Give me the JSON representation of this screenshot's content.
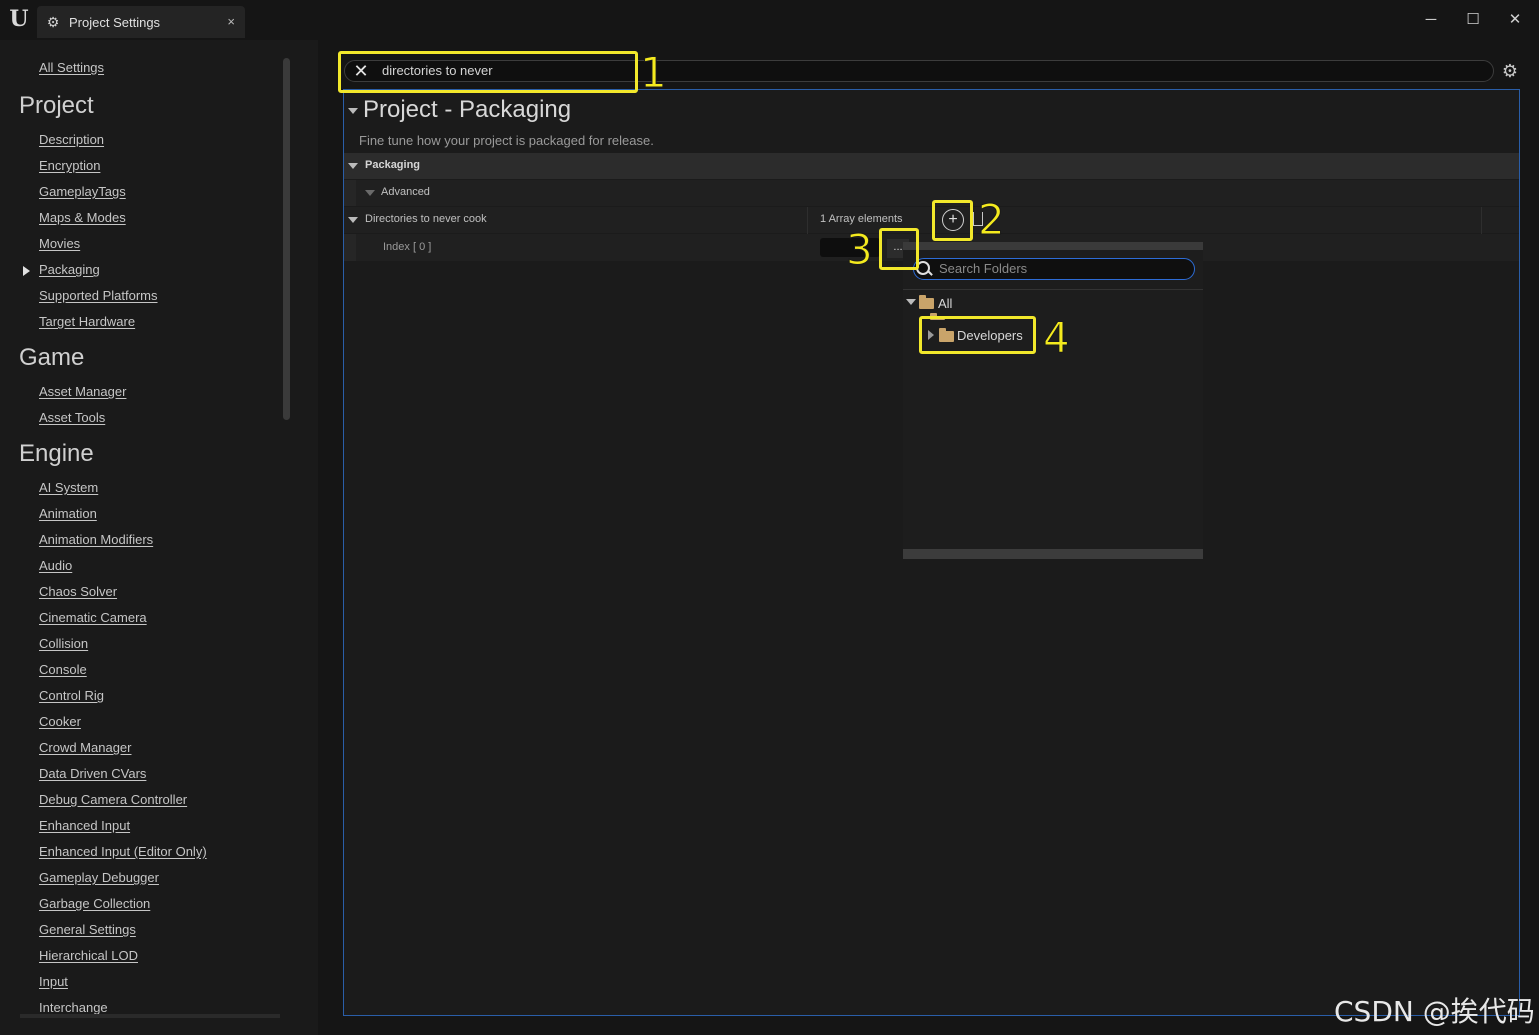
{
  "titlebar": {
    "tab_label": "Project Settings",
    "tab_close": "×",
    "minimize": "─",
    "maximize": "☐",
    "close": "✕"
  },
  "sidebar": {
    "all_settings": "All Settings",
    "sections": [
      {
        "heading": "Project",
        "items": [
          "Description",
          "Encryption",
          "GameplayTags",
          "Maps & Modes",
          "Movies",
          "Packaging",
          "Supported Platforms",
          "Target Hardware"
        ]
      },
      {
        "heading": "Game",
        "items": [
          "Asset Manager",
          "Asset Tools"
        ]
      },
      {
        "heading": "Engine",
        "items": [
          "AI System",
          "Animation",
          "Animation Modifiers",
          "Audio",
          "Chaos Solver",
          "Cinematic Camera",
          "Collision",
          "Console",
          "Control Rig",
          "Cooker",
          "Crowd Manager",
          "Data Driven CVars",
          "Debug Camera Controller",
          "Enhanced Input",
          "Enhanced Input (Editor Only)",
          "Gameplay Debugger",
          "Garbage Collection",
          "General Settings",
          "Hierarchical LOD",
          "Input",
          "Interchange"
        ]
      }
    ],
    "selected_item": "Packaging"
  },
  "search": {
    "value": "directories to never"
  },
  "section": {
    "title": "Project - Packaging",
    "description": "Fine tune how your project is packaged for release."
  },
  "rows": {
    "packaging": "Packaging",
    "advanced": "Advanced",
    "dirs_label": "Directories to never cook",
    "dirs_value": "1 Array elements",
    "index_label": "Index [ 0 ]",
    "browse": "..."
  },
  "popup": {
    "search_placeholder": "Search Folders",
    "tree": [
      "All",
      "Developers"
    ]
  },
  "callouts": [
    "1",
    "2",
    "3",
    "4"
  ],
  "watermark": "CSDN @挨代码",
  "colors": {
    "highlight": "#f2e82b",
    "accent": "#2a5ea8",
    "background": "#151515"
  }
}
